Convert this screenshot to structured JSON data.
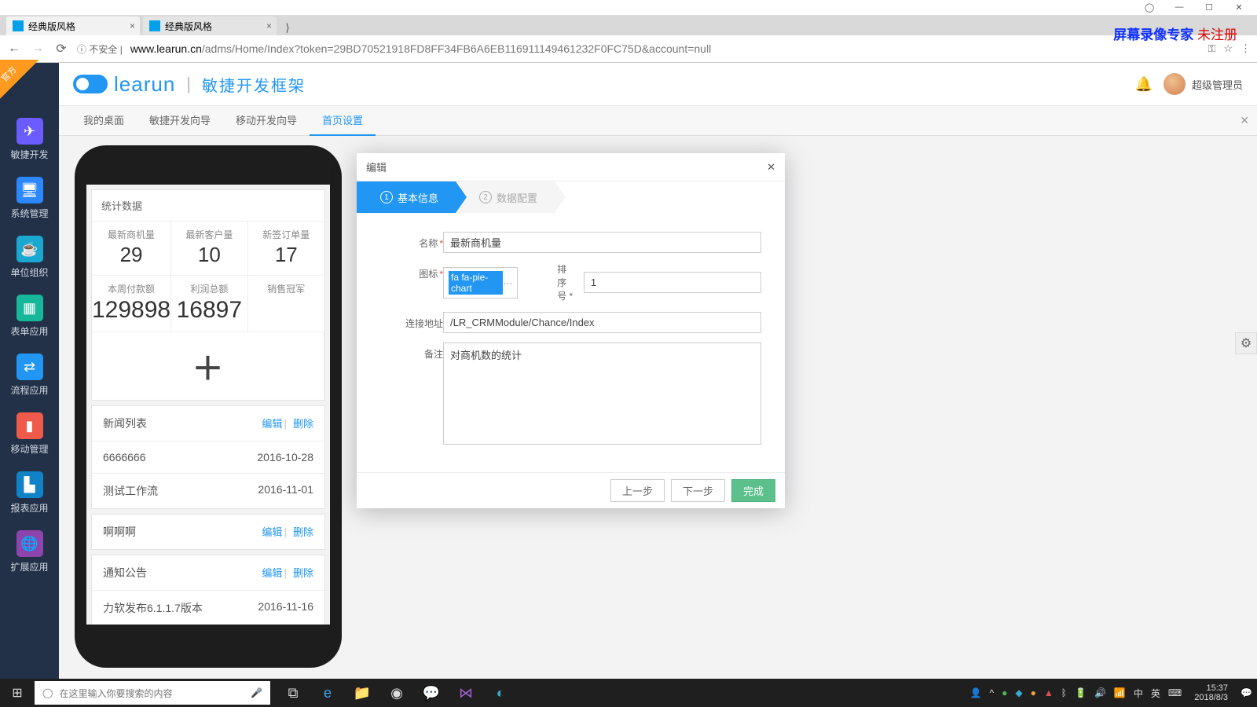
{
  "window": {
    "user_icon": "◯",
    "min": "—",
    "max": "☐",
    "close": "✕"
  },
  "recorder": {
    "prefix": "屏幕录像专家",
    "suffix": " 未注册"
  },
  "tabs": [
    {
      "title": "经典版风格",
      "active": true
    },
    {
      "title": "经典版风格",
      "active": false
    }
  ],
  "address": {
    "insecure": "不安全",
    "host": "www.learun.cn",
    "path": "/adms/Home/Index?token=29BD70521918FD8FF34FB6A6EB116911149461232F0FC75D&account=null"
  },
  "ribbon": "官方",
  "brand": "learun",
  "app_name": "敏捷开发框架",
  "topbar": {
    "user": "超级管理员"
  },
  "subnav": {
    "items": [
      "我的桌面",
      "敏捷开发向导",
      "移动开发向导",
      "首页设置"
    ],
    "active_index": 3
  },
  "sidebar": [
    {
      "label": "敏捷开发",
      "icon": "✈"
    },
    {
      "label": "系统管理",
      "icon": "🖥"
    },
    {
      "label": "单位组织",
      "icon": "☕"
    },
    {
      "label": "表单应用",
      "icon": "▦"
    },
    {
      "label": "流程应用",
      "icon": "⇄"
    },
    {
      "label": "移动管理",
      "icon": "▮"
    },
    {
      "label": "报表应用",
      "icon": "▙"
    },
    {
      "label": "扩展应用",
      "icon": "🌐"
    }
  ],
  "phone": {
    "stats_title": "统计数据",
    "cells": [
      {
        "lbl": "最新商机量",
        "val": "29"
      },
      {
        "lbl": "最新客户量",
        "val": "10"
      },
      {
        "lbl": "新签订单量",
        "val": "17"
      },
      {
        "lbl": "本周付款额",
        "val": "129898"
      },
      {
        "lbl": "利润总额",
        "val": "16897"
      },
      {
        "lbl": "销售冠军",
        "val": ""
      }
    ],
    "add": "＋",
    "news_title": "新闻列表",
    "edit": "编辑",
    "del": "删除",
    "rows": [
      {
        "t": "6666666",
        "d": "2016-10-28"
      },
      {
        "t": "测试工作流",
        "d": "2016-11-01"
      }
    ],
    "row3": {
      "t": "啊啊啊"
    },
    "notice_title": "通知公告",
    "row4": {
      "t": "力软发布6.1.1.7版本",
      "d": "2016-11-16"
    }
  },
  "modal": {
    "title": "编辑",
    "step1": "基本信息",
    "step2": "数据配置",
    "labels": {
      "name": "名称",
      "icon": "图标",
      "sort": "排序号",
      "link": "连接地址",
      "remark": "备注"
    },
    "values": {
      "name": "最新商机量",
      "icon_sel": "fa fa-pie-chart",
      "sort": "1",
      "link": "/LR_CRMModule/Chance/Index",
      "remark": "对商机数的统计"
    },
    "picker_dots": "···",
    "buttons": {
      "prev": "上一步",
      "next": "下一步",
      "done": "完成"
    }
  },
  "taskbar": {
    "search_placeholder": "在这里输入你要搜索的内容",
    "ime": [
      "中",
      "英"
    ],
    "time": "15:37",
    "date": "2018/8/3"
  }
}
